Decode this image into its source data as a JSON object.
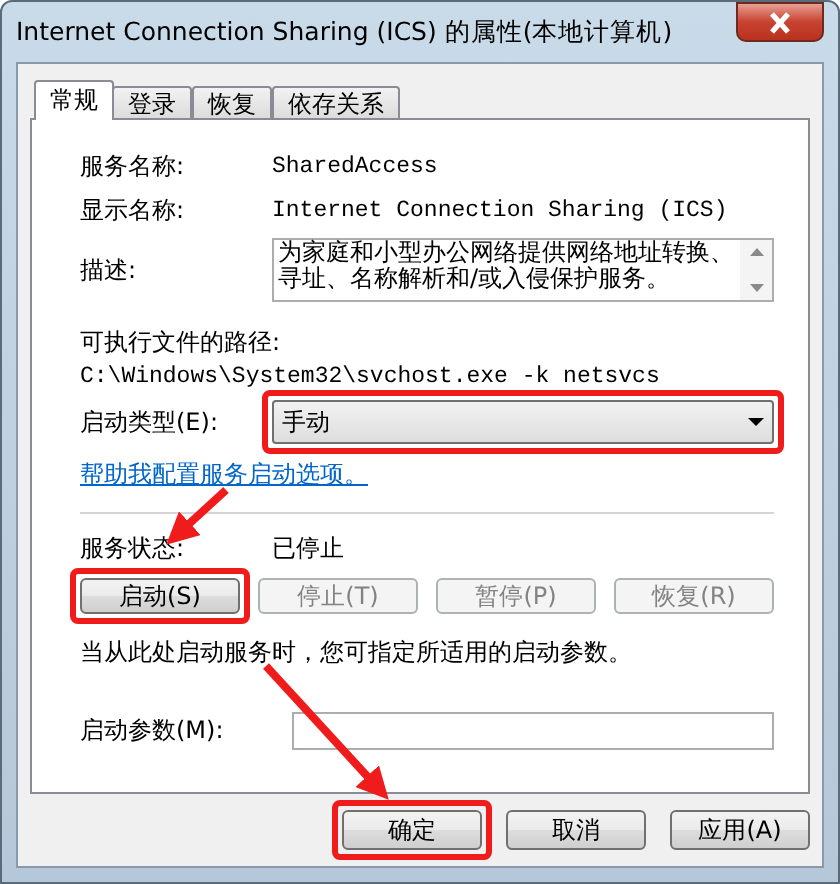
{
  "window": {
    "title": "Internet Connection Sharing (ICS) 的属性(本地计算机)"
  },
  "tabs": [
    {
      "label": "常规",
      "selected": true
    },
    {
      "label": "登录",
      "selected": false
    },
    {
      "label": "恢复",
      "selected": false
    },
    {
      "label": "依存关系",
      "selected": false
    }
  ],
  "info": [
    {
      "label": "服务名称:",
      "value": "SharedAccess"
    },
    {
      "label": "显示名称:",
      "value": "Internet Connection Sharing (ICS)"
    }
  ],
  "description": {
    "label": "描述:",
    "value": "为家庭和小型办公网络提供网络地址转换、寻址、名称解析和/或入侵保护服务。"
  },
  "executable": {
    "label": "可执行文件的路径:",
    "value": "C:\\Windows\\System32\\svchost.exe -k netsvcs"
  },
  "startup_type": {
    "label": "启动类型(E):",
    "value": "手动",
    "highlighted": true
  },
  "help_link": "帮助我配置服务启动选项。",
  "service_status": {
    "label": "服务状态:",
    "value": "已停止"
  },
  "service_buttons": [
    {
      "label": "启动(S)",
      "disabled": false,
      "highlighted": true
    },
    {
      "label": "停止(T)",
      "disabled": true,
      "highlighted": false
    },
    {
      "label": "暂停(P)",
      "disabled": true,
      "highlighted": false
    },
    {
      "label": "恢复(R)",
      "disabled": true,
      "highlighted": false
    }
  ],
  "hint": "当从此处启动服务时，您可指定所适用的启动参数。",
  "start_parameters": {
    "label": "启动参数(M):"
  },
  "dialog_buttons": [
    {
      "label": "确定",
      "highlighted": true,
      "disabled": false
    },
    {
      "label": "取消",
      "highlighted": false,
      "disabled": false
    },
    {
      "label": "应用(A)",
      "highlighted": false,
      "disabled": false
    }
  ]
}
